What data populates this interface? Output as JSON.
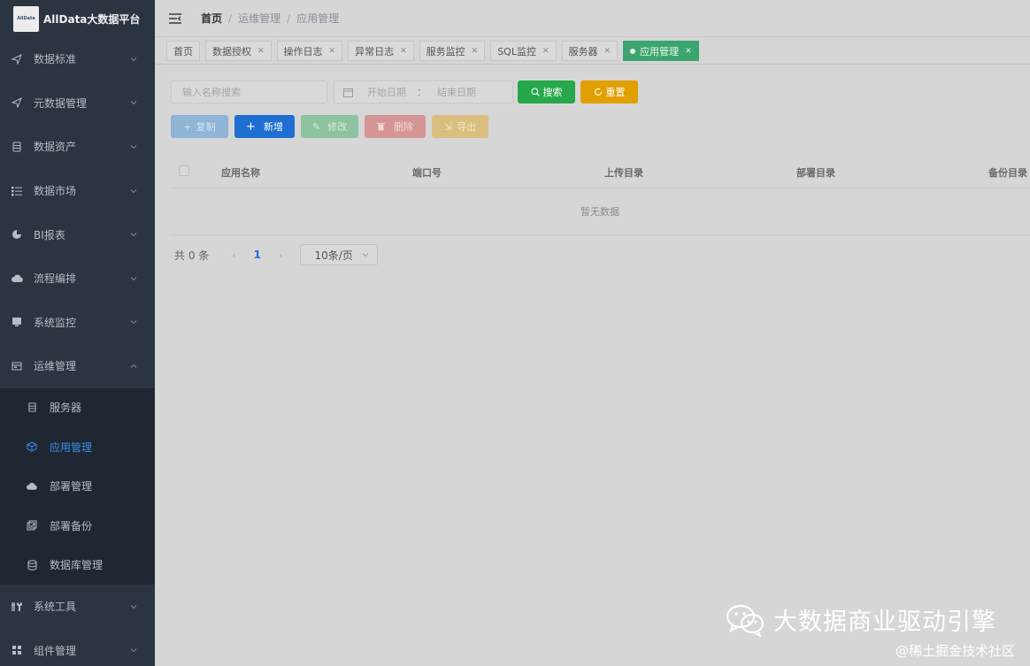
{
  "app": {
    "logo_text": "AllData",
    "title": "AllData大数据平台"
  },
  "sidebar": {
    "items": [
      {
        "label": "数据标准",
        "icon": "send-icon"
      },
      {
        "label": "元数据管理",
        "icon": "send-icon"
      },
      {
        "label": "数据资产",
        "icon": "database-icon"
      },
      {
        "label": "数据市场",
        "icon": "list-icon"
      },
      {
        "label": "BI报表",
        "icon": "chart-icon"
      },
      {
        "label": "流程编排",
        "icon": "cloud-icon"
      },
      {
        "label": "系统监控",
        "icon": "monitor-icon"
      },
      {
        "label": "运维管理",
        "icon": "server-icon",
        "expanded": true
      }
    ],
    "subitems": [
      {
        "label": "服务器",
        "icon": "server-icon"
      },
      {
        "label": "应用管理",
        "icon": "cube-icon",
        "active": true
      },
      {
        "label": "部署管理",
        "icon": "cloud-upload-icon"
      },
      {
        "label": "部署备份",
        "icon": "backup-icon"
      },
      {
        "label": "数据库管理",
        "icon": "database-icon"
      }
    ],
    "bottom_items": [
      {
        "label": "系统工具",
        "icon": "tools-icon"
      },
      {
        "label": "组件管理",
        "icon": "grid-icon"
      }
    ]
  },
  "breadcrumb": [
    "首页",
    "运维管理",
    "应用管理"
  ],
  "tabs": [
    {
      "label": "首页",
      "closable": false
    },
    {
      "label": "数据授权",
      "closable": true
    },
    {
      "label": "操作日志",
      "closable": true
    },
    {
      "label": "异常日志",
      "closable": true
    },
    {
      "label": "服务监控",
      "closable": true
    },
    {
      "label": "SQL监控",
      "closable": true
    },
    {
      "label": "服务器",
      "closable": true
    },
    {
      "label": "应用管理",
      "closable": true,
      "active": true
    }
  ],
  "filters": {
    "name_placeholder": "输入名称搜索",
    "start_placeholder": "开始日期",
    "range_separator": "：",
    "end_placeholder": "结束日期",
    "search_label": "搜索",
    "reset_label": "重置"
  },
  "actions": {
    "copy": "复制",
    "add": "新增",
    "edit": "修改",
    "delete": "删除",
    "export": "导出"
  },
  "table": {
    "columns": [
      "应用名称",
      "端口号",
      "上传目录",
      "部署目录",
      "备份目录"
    ],
    "empty_text": "暂无数据"
  },
  "pagination": {
    "total_text": "共 0 条",
    "current_page": "1",
    "page_size": "10条/页"
  },
  "watermark": {
    "text": "大数据商业驱动引擎",
    "sub": "@稀土掘金技术社区"
  },
  "colors": {
    "sidebar_bg": "#2b3441",
    "active_tab": "#3aa66e",
    "primary": "#1f6fd3",
    "search": "#27a84a",
    "reset": "#e0a100"
  }
}
